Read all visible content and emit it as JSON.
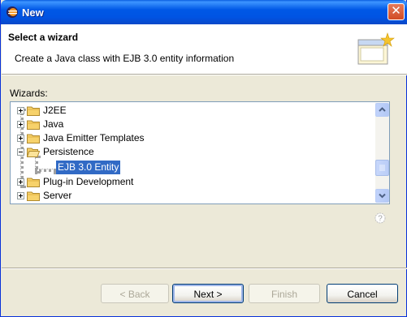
{
  "window": {
    "title": "New"
  },
  "header": {
    "title": "Select a wizard",
    "description": "Create a Java class with EJB 3.0 entity information"
  },
  "tree": {
    "label": "Wizards:",
    "items": [
      {
        "label": "J2EE",
        "expanded": false
      },
      {
        "label": "Java",
        "expanded": false
      },
      {
        "label": "Java Emitter Templates",
        "expanded": false
      },
      {
        "label": "Persistence",
        "expanded": true
      },
      {
        "label": "EJB 3.0 Entity",
        "selected": true
      },
      {
        "label": "Plug-in Development",
        "expanded": false
      },
      {
        "label": "Server",
        "expanded": false
      }
    ]
  },
  "buttons": {
    "back": "< Back",
    "next": "Next >",
    "finish": "Finish",
    "cancel": "Cancel"
  },
  "colors": {
    "selection": "#316ac5",
    "titlebar": "#0054e3",
    "close": "#d24b24"
  }
}
